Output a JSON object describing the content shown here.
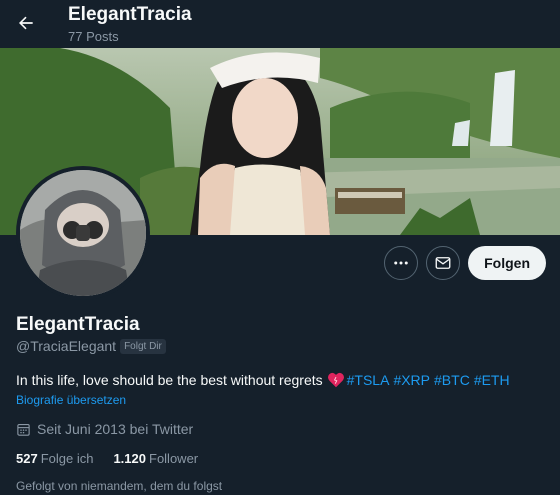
{
  "header": {
    "title": "ElegantTracia",
    "posts": "77 Posts"
  },
  "profile": {
    "display_name": "ElegantTracia",
    "handle": "@TraciaElegant",
    "follows_you_badge": "Folgt Dir",
    "bio_text": "In this life, love should be the best without regrets",
    "bio_hashtags": [
      "#TSLA",
      "#XRP",
      "#BTC",
      "#ETH"
    ],
    "translate_link": "Biografie übersetzen",
    "joined": "Seit Juni 2013 bei Twitter",
    "following_count": "527",
    "following_label": "Folge ich",
    "followers_count": "1.120",
    "followers_label": "Follower",
    "followed_by": "Gefolgt von niemandem, dem du folgst"
  },
  "actions": {
    "follow_label": "Folgen",
    "more_icon": "more-horizontal-icon",
    "message_icon": "mail-icon"
  },
  "colors": {
    "background": "#15202b",
    "accent": "#1d9bf0",
    "muted": "#8b98a5"
  }
}
